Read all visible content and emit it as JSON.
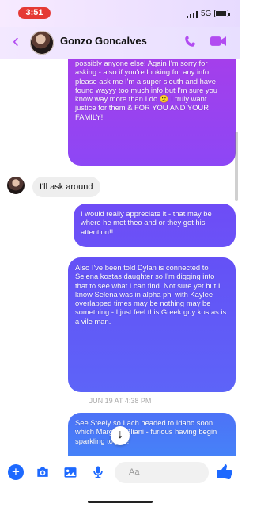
{
  "status": {
    "time": "3:51",
    "network": "5G"
  },
  "header": {
    "contact_name": "Gonzo Goncalves",
    "back_icon": "chevron-left-icon",
    "call_icon": "phone-icon",
    "video_icon": "video-camera-icon"
  },
  "messages": [
    {
      "type": "outgoing",
      "text": "possibly anyone else! Again I'm sorry for asking - also if you're looking for any info please ask me I'm a super sleuth and have found wayyy too much info but I'm sure you know way more than I do 😕 I truly want justice for them & FOR YOU AND YOUR FAMILY!"
    },
    {
      "type": "incoming",
      "text": "I'll ask around"
    },
    {
      "type": "outgoing",
      "text": "I would really appreciate it - that may be where he met theo and or they got his attention!!"
    },
    {
      "type": "outgoing",
      "text": "Also I've been told Dylan is connected to Selena kostas daughter so I'm digging into that to see what I can find. Not sure yet but I know Selena was in alpha phi with Kaylee overlapped times may be nothing may be something - I just feel this Greek guy kostas is a vile man."
    },
    {
      "type": "timestamp",
      "text": "JUN 19 AT 4:38 PM"
    },
    {
      "type": "outgoing",
      "text": "See Steely so I ach headed to Idaho soon which Margaro Bliani - furious having begin sparkling to you!"
    }
  ],
  "composer": {
    "placeholder": "Aa",
    "plus_icon": "plus-icon",
    "camera_icon": "camera-icon",
    "gallery_icon": "image-icon",
    "mic_icon": "microphone-icon",
    "emoji_icon": "emoji-icon",
    "like_icon": "thumbs-up-icon",
    "scroll_icon": "down-arrow-icon",
    "scroll_label": "↓"
  },
  "colors": {
    "accent": "#b24cf1",
    "blue": "#1d69ff",
    "status_red": "#e53935"
  }
}
